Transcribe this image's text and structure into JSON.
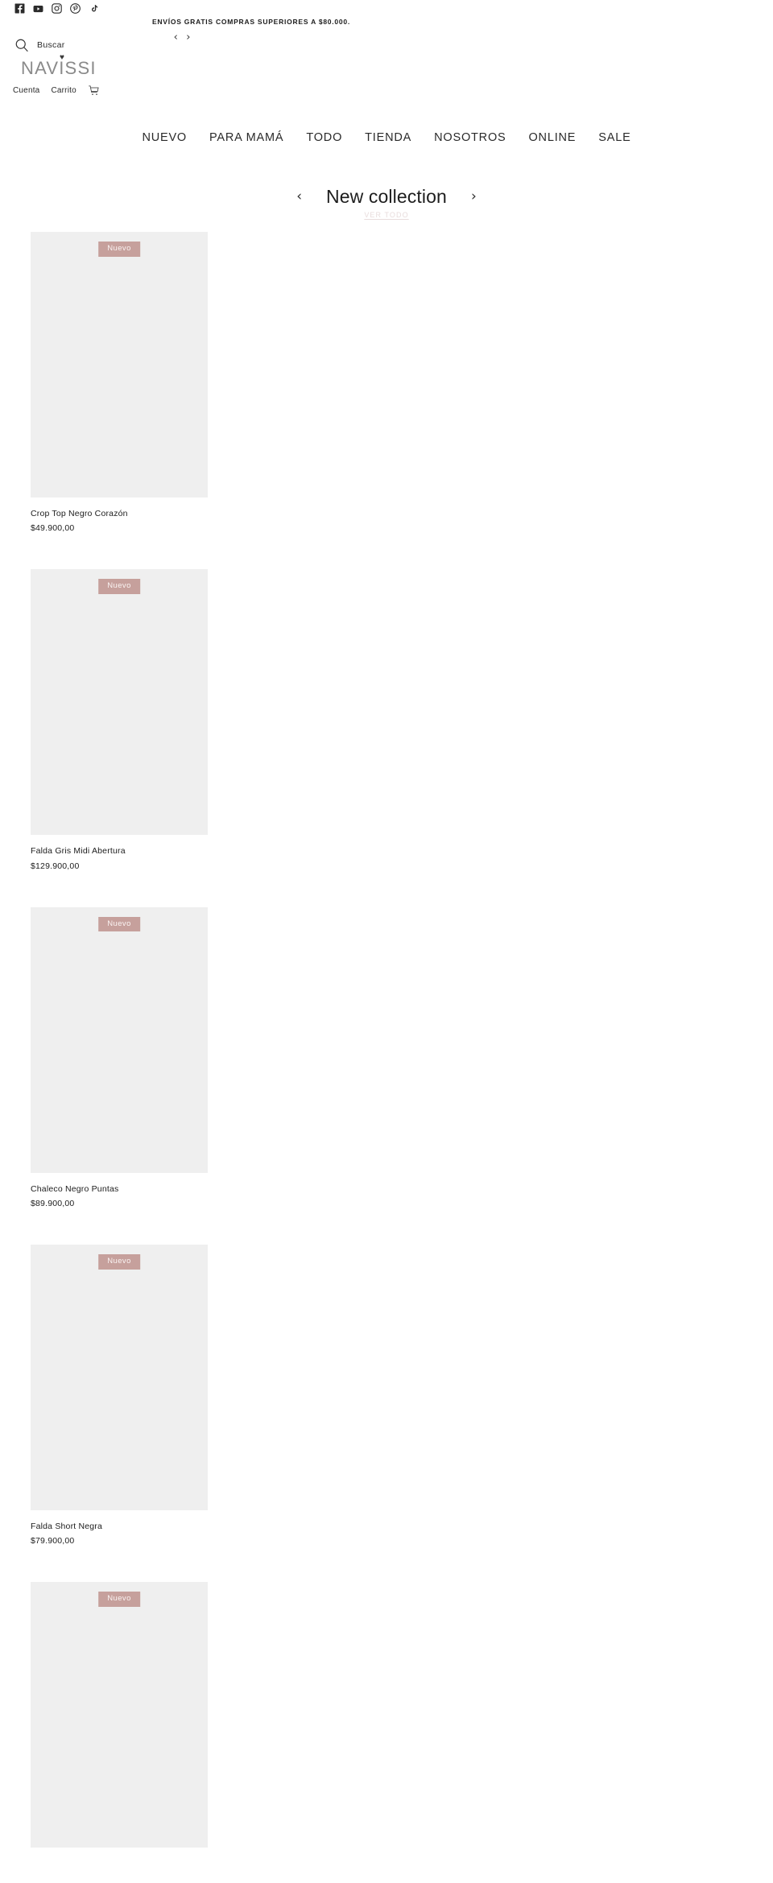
{
  "topbar": {
    "social": [
      {
        "name": "facebook-icon",
        "label": "Facebook"
      },
      {
        "name": "youtube-icon",
        "label": "YouTube"
      },
      {
        "name": "instagram-icon",
        "label": "Instagram"
      },
      {
        "name": "pinterest-icon",
        "label": "Pinterest"
      },
      {
        "name": "tiktok-icon",
        "label": "TikTok"
      }
    ],
    "announcement": "ENVÍOS GRATIS COMPRAS SUPERIORES A $80.000.",
    "prev_arrow": "‹",
    "next_arrow": "›"
  },
  "search": {
    "icon": "search-icon",
    "label": "Buscar",
    "placeholder": "Buscar"
  },
  "brand": {
    "name": "NAVISSI",
    "mark": "♥"
  },
  "account": {
    "account_label": "Cuenta",
    "cart_label": "Carrito",
    "cart_icon": "shopping-cart-icon"
  },
  "nav": {
    "items": [
      {
        "label": "NUEVO"
      },
      {
        "label": "PARA MAMÁ"
      },
      {
        "label": "TODO"
      },
      {
        "label": "TIENDA"
      },
      {
        "label": "NOSOTROS"
      },
      {
        "label": "ONLINE"
      },
      {
        "label": "SALE"
      }
    ]
  },
  "collection": {
    "title": "New collection",
    "prev_arrow": "‹",
    "next_arrow": "›",
    "view_all": "VER TODO"
  },
  "products": [
    {
      "badge": "Nuevo",
      "title": "Crop Top Negro Corazón",
      "price": "$49.900,00"
    },
    {
      "badge": "Nuevo",
      "title": "Falda Gris Midi Abertura",
      "price": "$129.900,00"
    },
    {
      "badge": "Nuevo",
      "title": "Chaleco Negro Puntas",
      "price": "$89.900,00"
    },
    {
      "badge": "Nuevo",
      "title": "Falda Short Negra",
      "price": "$79.900,00"
    },
    {
      "badge": "Nuevo",
      "title": "",
      "price": ""
    }
  ],
  "colors": {
    "badge_bg": "#c6a09c",
    "badge_text": "#fbf4f3",
    "placeholder": "#efefef",
    "view_all": "#e8dcdc",
    "text": "#1c1c1c",
    "logo": "#8a8a8a"
  }
}
